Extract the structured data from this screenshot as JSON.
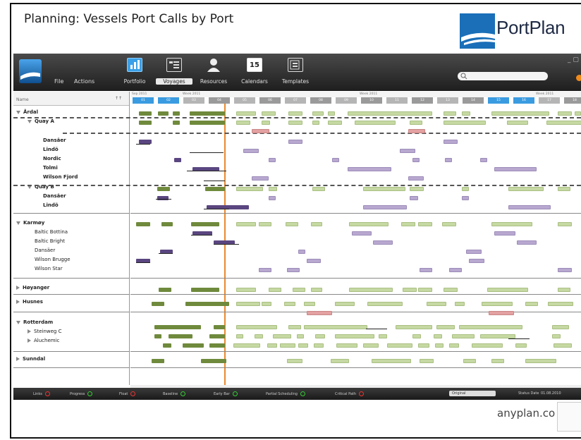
{
  "slide": {
    "title": "Planning: Vessels Port Calls by Port",
    "logo_text": "PortPlan",
    "footer_text": "anyplan.co"
  },
  "toolbar": {
    "menu": [
      "File",
      "Actions"
    ],
    "buttons": [
      "Portfolio",
      "Voyages",
      "Resources",
      "Calendars",
      "Templates"
    ],
    "calendar_day": "15",
    "window_controls": "_ ▢"
  },
  "tree": {
    "header": "Name",
    "sort_label": "↑↑",
    "rows": [
      {
        "label": "Årdal",
        "level": 0,
        "state": "open"
      },
      {
        "label": "Quay A",
        "level": 1,
        "state": "open"
      },
      {
        "label": "Dansäer",
        "level": 2
      },
      {
        "label": "Lindö",
        "level": 2
      },
      {
        "label": "Nordic",
        "level": 2
      },
      {
        "label": "Tolmi",
        "level": 2
      },
      {
        "label": "Wilson Fjord",
        "level": 2
      },
      {
        "label": "Quay B",
        "level": 1,
        "state": "open"
      },
      {
        "label": "Dansäer",
        "level": 2
      },
      {
        "label": "Lindö",
        "level": 2
      },
      {
        "label": "Karmøy",
        "level": 0,
        "state": "open"
      },
      {
        "label": "Baltic Bottina",
        "level": 1
      },
      {
        "label": "Baltic Bright",
        "level": 1
      },
      {
        "label": "Dansäer",
        "level": 1
      },
      {
        "label": "Wilson Brugge",
        "level": 1
      },
      {
        "label": "Wilson Star",
        "level": 1
      },
      {
        "label": "Høyanger",
        "level": 0,
        "state": "closed"
      },
      {
        "label": "Husnes",
        "level": 0,
        "state": "closed"
      },
      {
        "label": "Rotterdam",
        "level": 0,
        "state": "open"
      },
      {
        "label": "Steinweg C",
        "level": 1,
        "state": "closed"
      },
      {
        "label": "Aluchemic",
        "level": 1,
        "state": "closed"
      },
      {
        "label": "Sunndal",
        "level": 0,
        "state": "closed"
      }
    ]
  },
  "timescale": {
    "months": [
      "Sep 2011",
      "Week 2011",
      "Week 2011",
      "Week 2011"
    ],
    "days": [
      "01",
      "02",
      "03",
      "04",
      "05",
      "06",
      "07",
      "08",
      "09",
      "10",
      "11",
      "12",
      "13",
      "14",
      "15",
      "16",
      "17",
      "18"
    ]
  },
  "statusbar": {
    "items": [
      "Links",
      "Progress",
      "Float",
      "Baseline",
      "Early Bar",
      "Partial Scheduling",
      "Critical Path"
    ],
    "states": [
      "off",
      "on",
      "off",
      "on",
      "on",
      "on",
      "off"
    ],
    "select_value": "Original",
    "status_date_label": "Status Date",
    "status_date": "01.08.2010"
  },
  "colors": {
    "proposed": "#c6d9a3",
    "confirmed": "#6f8a3c",
    "vessel": "#b8a8d0",
    "vessel_active": "#5a4680",
    "conflict": "#e3a1a1",
    "today_line": "#e9892e",
    "highlight_day": "#3a9be0"
  }
}
